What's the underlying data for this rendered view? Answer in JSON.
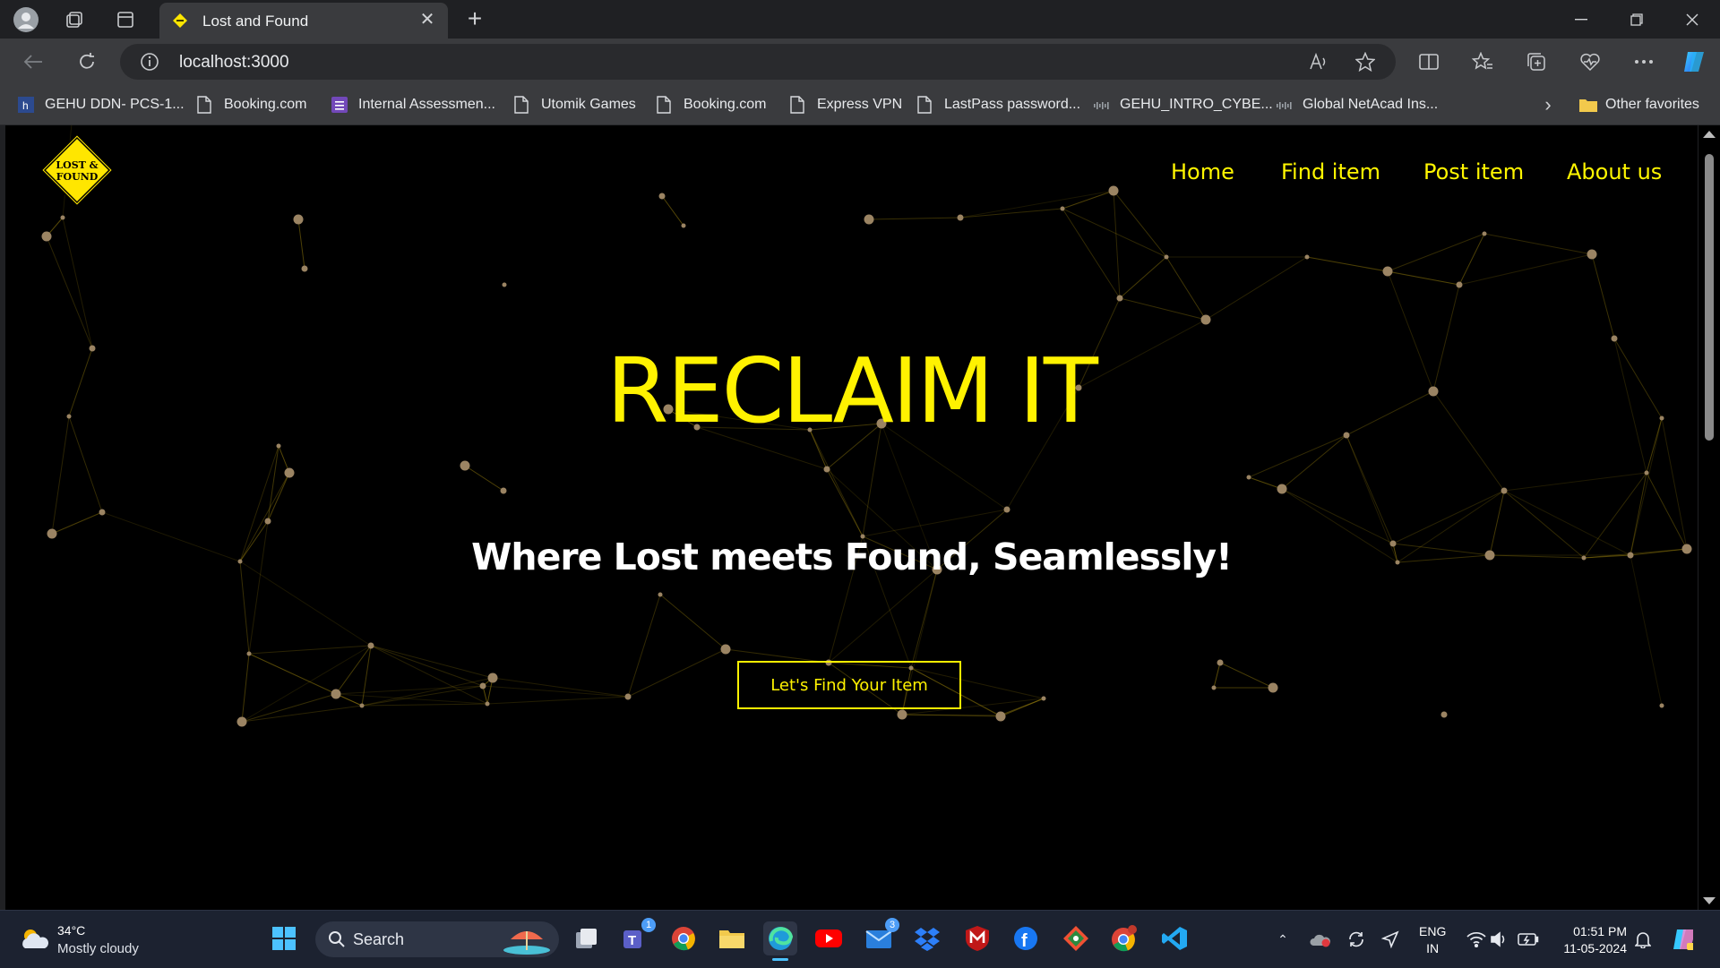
{
  "browser": {
    "tab": {
      "title": "Lost and Found"
    },
    "address": "localhost:3000",
    "favorites": [
      {
        "label": "GEHU DDN- PCS-1...",
        "icon": "gehu-icon"
      },
      {
        "label": "Booking.com",
        "icon": "page-icon"
      },
      {
        "label": "Internal Assessmen...",
        "icon": "forms-icon"
      },
      {
        "label": "Utomik Games",
        "icon": "page-icon"
      },
      {
        "label": "Booking.com",
        "icon": "page-icon"
      },
      {
        "label": "Express VPN",
        "icon": "page-icon"
      },
      {
        "label": "LastPass password...",
        "icon": "page-icon"
      },
      {
        "label": "GEHU_INTRO_CYBE...",
        "icon": "cisco-icon"
      },
      {
        "label": "Global NetAcad Ins...",
        "icon": "cisco-icon"
      }
    ],
    "other_favorites": "Other favorites"
  },
  "site": {
    "logo_text": [
      "LOST &",
      "FOUND"
    ],
    "nav": [
      "Home",
      "Find item",
      "Post item",
      "About us"
    ],
    "hero_title": "RECLAIM IT",
    "hero_subtitle": "Where Lost meets Found, Seamlessly!",
    "cta_label": "Let's Find Your Item",
    "accent_color": "#fff200"
  },
  "taskbar": {
    "weather_temp": "34°C",
    "weather_desc": "Mostly cloudy",
    "search_label": "Search",
    "badges": {
      "teams": "1",
      "mail": "3"
    },
    "lang_line1": "ENG",
    "lang_line2": "IN",
    "time": "01:51 PM",
    "date": "11-05-2024"
  }
}
